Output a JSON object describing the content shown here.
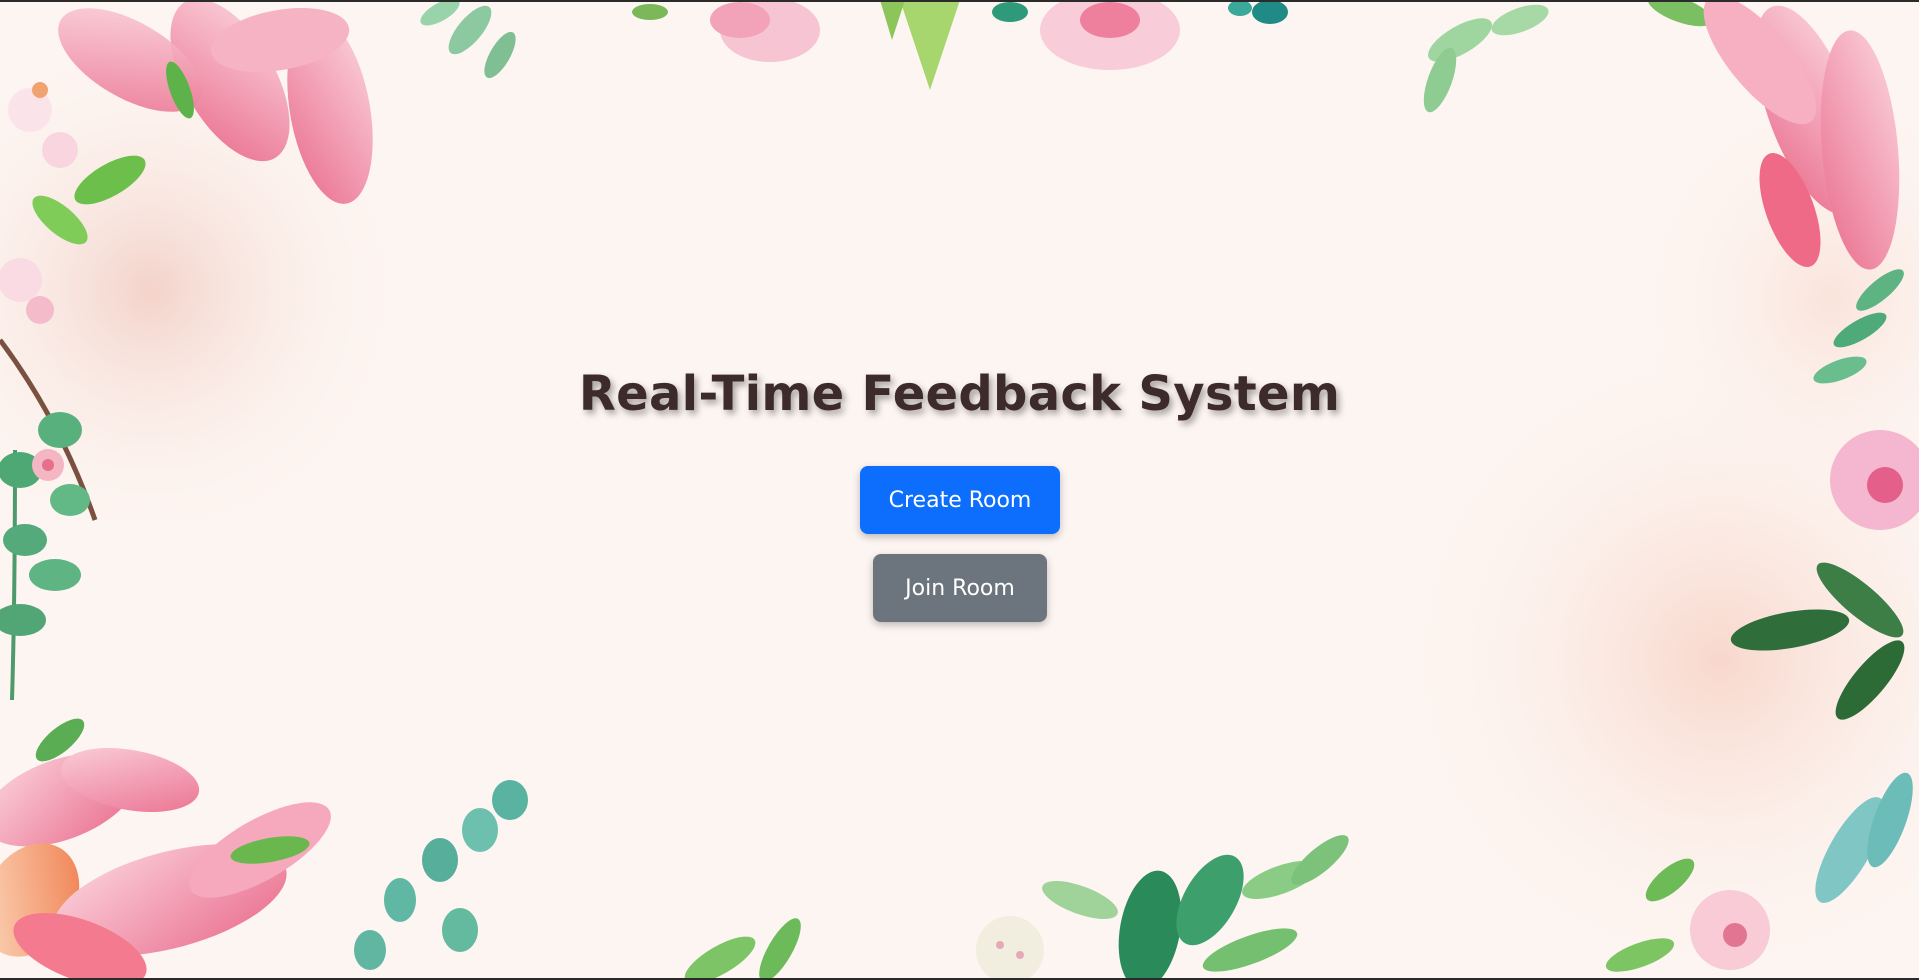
{
  "page": {
    "title": "Real-Time Feedback System",
    "background_color": "#fdf5f1"
  },
  "actions": {
    "create_label": "Create Room",
    "join_label": "Join Room",
    "create_color": "#0d6efd",
    "join_color": "#6c757d"
  },
  "decor": {
    "style": "watercolor floral border",
    "flower_pink": "#f08aa8",
    "leaf_green": "#4fae7a",
    "leaf_teal": "#3aa89a"
  }
}
